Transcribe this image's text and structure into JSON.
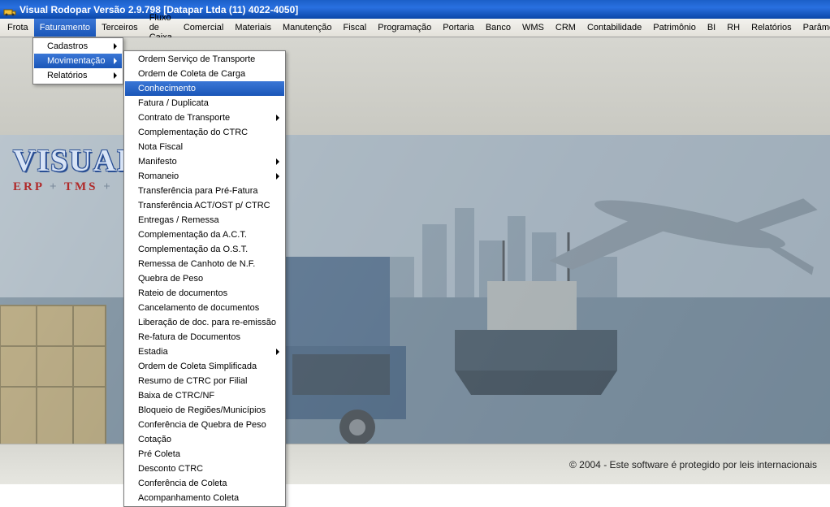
{
  "title": "Visual Rodopar Versão 2.9.798 [Datapar Ltda (11) 4022-4050]",
  "menubar": [
    "Frota",
    "Faturamento",
    "Terceiros",
    "Fluxo de Caixa",
    "Comercial",
    "Materiais",
    "Manutenção",
    "Fiscal",
    "Programação",
    "Portaria",
    "Banco",
    "WMS",
    "CRM",
    "Contabilidade",
    "Patrimônio",
    "BI",
    "RH",
    "Relatórios",
    "Parâmetros"
  ],
  "menubar_open_index": 1,
  "brand": {
    "visual": "VISUAL",
    "sub_erp": "ERP",
    "sub_plus": "+",
    "sub_tms": "TMS",
    "sub_plus2": "+"
  },
  "footer": "©  2004 - Este software é protegido por leis internacionais",
  "submenu1": [
    {
      "label": "Cadastros",
      "sub": true
    },
    {
      "label": "Movimentação",
      "sub": true,
      "hl": true
    },
    {
      "label": "Relatórios",
      "sub": true
    }
  ],
  "submenu2": [
    {
      "label": "Ordem Serviço de Transporte"
    },
    {
      "label": "Ordem de Coleta de Carga"
    },
    {
      "label": "Conhecimento",
      "hl": true
    },
    {
      "label": "Fatura / Duplicata"
    },
    {
      "label": "Contrato de Transporte",
      "sub": true
    },
    {
      "label": "Complementação do CTRC"
    },
    {
      "label": "Nota Fiscal"
    },
    {
      "label": "Manifesto",
      "sub": true
    },
    {
      "label": "Romaneio",
      "sub": true
    },
    {
      "label": "Transferência para Pré-Fatura"
    },
    {
      "label": "Transferência ACT/OST p/ CTRC"
    },
    {
      "label": "Entregas / Remessa"
    },
    {
      "label": "Complementação da A.C.T."
    },
    {
      "label": "Complementação da O.S.T."
    },
    {
      "label": "Remessa de Canhoto de N.F."
    },
    {
      "label": "Quebra de Peso"
    },
    {
      "label": "Rateio de documentos"
    },
    {
      "label": "Cancelamento de documentos"
    },
    {
      "label": "Liberação de doc. para re-emissão"
    },
    {
      "label": "Re-fatura de Documentos"
    },
    {
      "label": "Estadia",
      "sub": true
    },
    {
      "label": "Ordem de Coleta Simplificada"
    },
    {
      "label": "Resumo de CTRC por Filial"
    },
    {
      "label": "Baixa de CTRC/NF"
    },
    {
      "label": "Bloqueio de Regiões/Municípios"
    },
    {
      "label": "Conferência de Quebra de Peso"
    },
    {
      "label": "Cotação"
    },
    {
      "label": "Pré Coleta"
    },
    {
      "label": "Desconto CTRC"
    },
    {
      "label": "Conferência de Coleta"
    },
    {
      "label": "Acompanhamento Coleta"
    }
  ]
}
